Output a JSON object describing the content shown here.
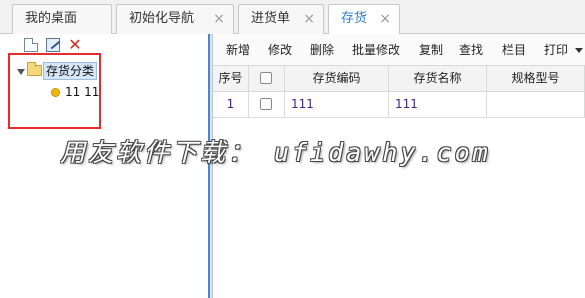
{
  "tabs": [
    {
      "label": "我的桌面",
      "closable": false,
      "active": false
    },
    {
      "label": "初始化导航",
      "closable": true,
      "active": false
    },
    {
      "label": "进货单",
      "closable": true,
      "active": false
    },
    {
      "label": "存货",
      "closable": true,
      "active": true
    }
  ],
  "close_glyph": "×",
  "left_toolbar": {
    "icons": [
      "new-file-icon",
      "edit-icon",
      "delete-icon"
    ],
    "delete_glyph": "✕"
  },
  "tree": {
    "root": {
      "label": "存货分类",
      "expanded": true
    },
    "children": [
      {
        "label": "11 11"
      }
    ]
  },
  "toolbar": {
    "buttons": [
      "新增",
      "修改",
      "删除",
      "批量修改",
      "复制",
      "查找",
      "栏目",
      "打印"
    ]
  },
  "grid": {
    "headers": [
      "序号",
      "",
      "存货编码",
      "存货名称",
      "规格型号"
    ],
    "rows": [
      {
        "index": "1",
        "code": "111",
        "name": "111",
        "spec": ""
      }
    ]
  },
  "watermark": "用友软件下载： ufidawhy.com",
  "colors": {
    "active_tab_text": "#2a7fc9",
    "highlight_box": "#e52b2b",
    "splitter": "#4a86c8",
    "grid_value_text": "#3a2a8c"
  }
}
